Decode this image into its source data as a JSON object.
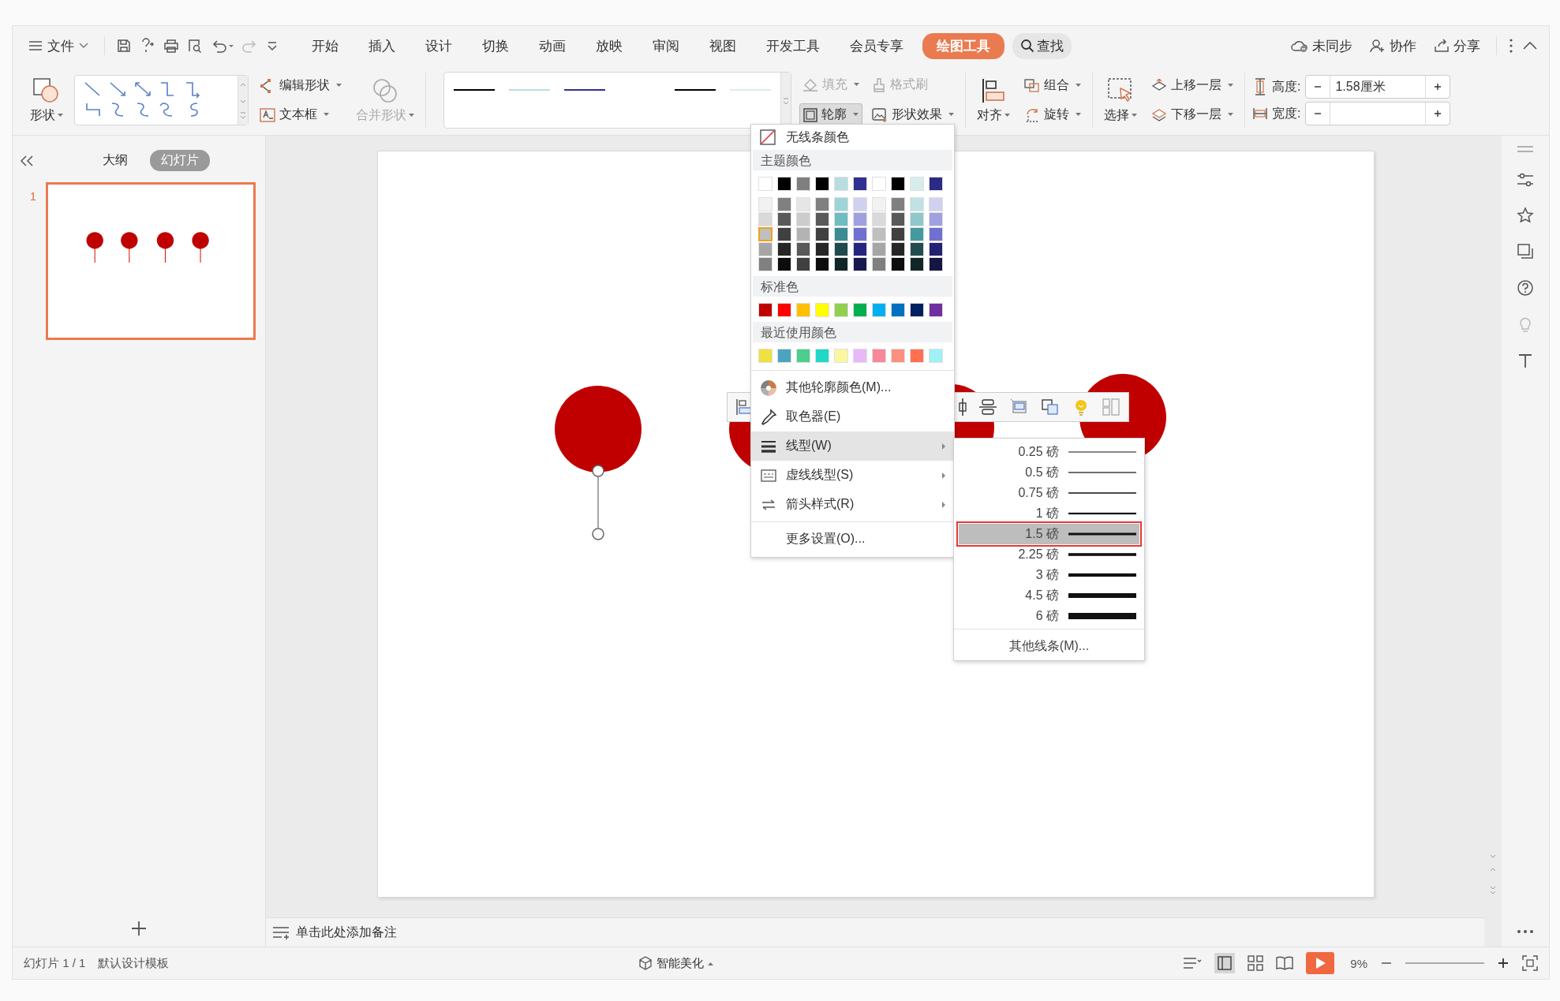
{
  "menu_bar": {
    "file": "文件",
    "tabs": [
      {
        "label": "开始",
        "selected": false
      },
      {
        "label": "插入",
        "selected": false
      },
      {
        "label": "设计",
        "selected": false
      },
      {
        "label": "切换",
        "selected": false
      },
      {
        "label": "动画",
        "selected": false
      },
      {
        "label": "放映",
        "selected": false
      },
      {
        "label": "审阅",
        "selected": false
      },
      {
        "label": "视图",
        "selected": false
      },
      {
        "label": "开发工具",
        "selected": false
      },
      {
        "label": "会员专享",
        "selected": false
      },
      {
        "label": "绘图工具",
        "selected": true
      }
    ],
    "search": "查找",
    "sync": "未同步",
    "collab": "协作",
    "share": "分享"
  },
  "ribbon": {
    "shape": "形状",
    "edit_shape": "编辑形状",
    "text_box": "文本框",
    "merge_shape": {
      "label": "合并形状",
      "disabled": true
    },
    "fill": {
      "label": "填充",
      "disabled": true
    },
    "format_painter": {
      "label": "格式刷",
      "disabled": true
    },
    "outline": {
      "label": "轮廓",
      "pressed": true
    },
    "shape_effect": "形状效果",
    "align": "对齐",
    "group": "组合",
    "rotate": "旋转",
    "select": "选择",
    "bring_forward": "上移一层",
    "send_backward": "下移一层",
    "height": {
      "label": "高度:",
      "value": "1.58厘米"
    },
    "width": {
      "label": "宽度:"
    }
  },
  "sidebar": {
    "tabs": [
      {
        "label": "大纲",
        "selected": false
      },
      {
        "label": "幻灯片",
        "selected": true
      }
    ],
    "slides": [
      {
        "number": "1",
        "selected": true
      }
    ]
  },
  "notes": {
    "placeholder": "单击此处添加备注"
  },
  "outline_menu": {
    "no_line": "无线条颜色",
    "theme_title": "主题颜色",
    "theme_top": [
      {
        "color": "#ffffff"
      },
      {
        "color": "#000000"
      },
      {
        "color": "#7f7f7f"
      },
      {
        "color": "#000000"
      },
      {
        "color": "#b7dde0"
      },
      {
        "color": "#303090"
      },
      {
        "color": "#ffffff"
      },
      {
        "color": "#000000"
      },
      {
        "color": "#d8ecee"
      },
      {
        "color": "#2b2b85"
      }
    ],
    "theme_shades": [
      [
        {
          "color": "#f2f2f2",
          "selected": false
        },
        {
          "color": "#d9d9d9",
          "selected": false
        },
        {
          "color": "#bfbfbf",
          "selected": true
        },
        {
          "color": "#a6a6a6",
          "selected": false
        },
        {
          "color": "#808080",
          "selected": false
        }
      ],
      [
        {
          "color": "#808080",
          "selected": false
        },
        {
          "color": "#595959",
          "selected": false
        },
        {
          "color": "#404040",
          "selected": false
        },
        {
          "color": "#262626",
          "selected": false
        },
        {
          "color": "#0d0d0d",
          "selected": false
        }
      ],
      [
        {
          "color": "#e6e6e6",
          "selected": false
        },
        {
          "color": "#cccccc",
          "selected": false
        },
        {
          "color": "#b3b3b3",
          "selected": false
        },
        {
          "color": "#595959",
          "selected": false
        },
        {
          "color": "#404040",
          "selected": false
        }
      ],
      [
        {
          "color": "#808080",
          "selected": false
        },
        {
          "color": "#595959",
          "selected": false
        },
        {
          "color": "#404040",
          "selected": false
        },
        {
          "color": "#262626",
          "selected": false
        },
        {
          "color": "#0d0d0d",
          "selected": false
        }
      ],
      [
        {
          "color": "#9dd4d8",
          "selected": false
        },
        {
          "color": "#6dbdc3",
          "selected": false
        },
        {
          "color": "#3a8c92",
          "selected": false
        },
        {
          "color": "#1f4a4e",
          "selected": false
        },
        {
          "color": "#0f2526",
          "selected": false
        }
      ],
      [
        {
          "color": "#d0d0f0",
          "selected": false
        },
        {
          "color": "#a0a0e0",
          "selected": false
        },
        {
          "color": "#7070d0",
          "selected": false
        },
        {
          "color": "#252580",
          "selected": false
        },
        {
          "color": "#181850",
          "selected": false
        }
      ],
      [
        {
          "color": "#f2f2f2",
          "selected": false
        },
        {
          "color": "#d9d9d9",
          "selected": false
        },
        {
          "color": "#bfbfbf",
          "selected": false
        },
        {
          "color": "#a6a6a6",
          "selected": false
        },
        {
          "color": "#808080",
          "selected": false
        }
      ],
      [
        {
          "color": "#808080",
          "selected": false
        },
        {
          "color": "#595959",
          "selected": false
        },
        {
          "color": "#404040",
          "selected": false
        },
        {
          "color": "#262626",
          "selected": false
        },
        {
          "color": "#0d0d0d",
          "selected": false
        }
      ],
      [
        {
          "color": "#c0e2e4",
          "selected": false
        },
        {
          "color": "#8ec8cb",
          "selected": false
        },
        {
          "color": "#459a9f",
          "selected": false
        },
        {
          "color": "#224d50",
          "selected": false
        },
        {
          "color": "#112627",
          "selected": false
        }
      ],
      [
        {
          "color": "#d0d0f0",
          "selected": false
        },
        {
          "color": "#a0a0e0",
          "selected": false
        },
        {
          "color": "#7070d0",
          "selected": false
        },
        {
          "color": "#222270",
          "selected": false
        },
        {
          "color": "#161645",
          "selected": false
        }
      ]
    ],
    "standard_title": "标准色",
    "standard": [
      {
        "color": "#c00000"
      },
      {
        "color": "#ff0000"
      },
      {
        "color": "#ffc000"
      },
      {
        "color": "#ffff00"
      },
      {
        "color": "#92d050"
      },
      {
        "color": "#00b050"
      },
      {
        "color": "#00b0f0"
      },
      {
        "color": "#0070c0"
      },
      {
        "color": "#002060"
      },
      {
        "color": "#7030a0"
      }
    ],
    "recent_title": "最近使用颜色",
    "recent": [
      {
        "color": "#f0e040"
      },
      {
        "color": "#4ba3c0"
      },
      {
        "color": "#4cce8e"
      },
      {
        "color": "#20d8c8"
      },
      {
        "color": "#fbf7a0"
      },
      {
        "color": "#e8b8f8"
      },
      {
        "color": "#f88898"
      },
      {
        "color": "#fa9080"
      },
      {
        "color": "#fe7050"
      },
      {
        "color": "#a0f0f8"
      }
    ],
    "items": [
      {
        "label": "其他轮廓颜色(M)...",
        "kind": "palette",
        "submenu": false,
        "selected": false
      },
      {
        "label": "取色器(E)",
        "kind": "eyedropper",
        "submenu": false,
        "selected": false
      },
      {
        "label": "线型(W)",
        "kind": "lines",
        "submenu": true,
        "selected": true
      },
      {
        "label": "虚线线型(S)",
        "kind": "dashes",
        "submenu": true,
        "selected": false
      },
      {
        "label": "箭头样式(R)",
        "kind": "arrows",
        "submenu": true,
        "selected": false
      },
      {
        "label": "更多设置(O)...",
        "kind": "plain",
        "submenu": false,
        "selected": false
      }
    ]
  },
  "line_weight_menu": {
    "items": [
      {
        "label": "0.25 磅",
        "selected": false
      },
      {
        "label": "0.5 磅",
        "selected": false
      },
      {
        "label": "0.75 磅",
        "selected": false
      },
      {
        "label": "1 磅",
        "selected": false
      },
      {
        "label": "1.5 磅",
        "selected": true
      },
      {
        "label": "2.25 磅",
        "selected": false
      },
      {
        "label": "3 磅",
        "selected": false
      },
      {
        "label": "4.5 磅",
        "selected": false
      },
      {
        "label": "6 磅",
        "selected": false
      }
    ],
    "more": "其他线条(M)..."
  },
  "status_bar": {
    "slide": "幻灯片 1 / 1",
    "template": "默认设计模板",
    "beautify": "智能美化",
    "zoom": "9%"
  }
}
